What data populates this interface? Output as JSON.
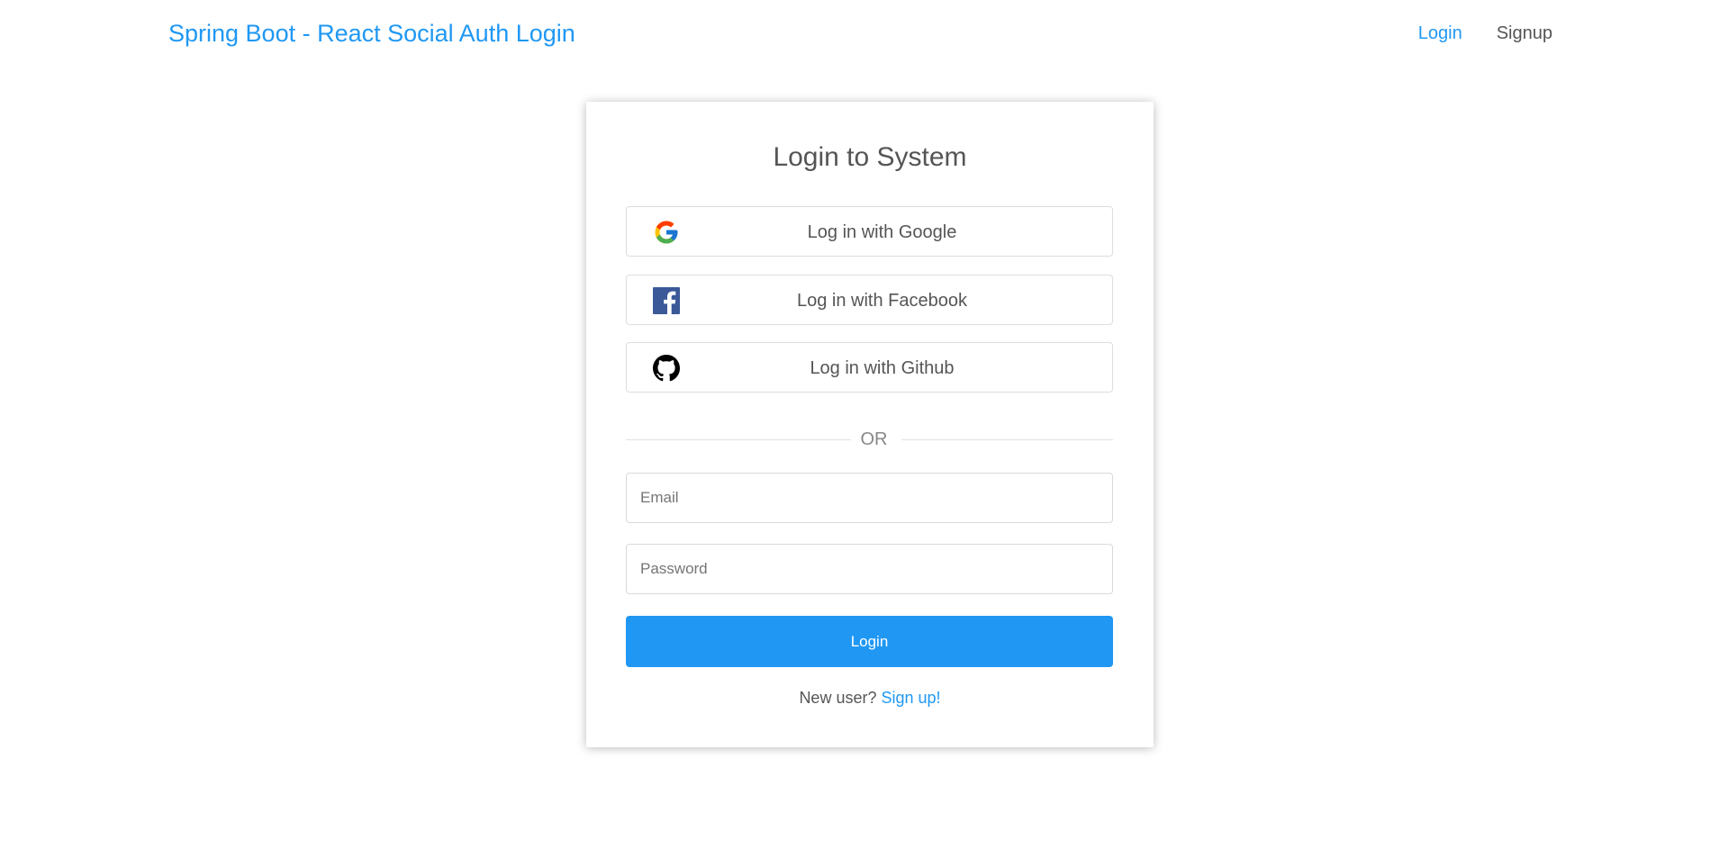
{
  "header": {
    "app_title": "Spring Boot - React Social Auth Login",
    "nav": {
      "login": "Login",
      "signup": "Signup"
    }
  },
  "login_card": {
    "title": "Login to System",
    "social": {
      "google": {
        "label": "Log in with Google",
        "icon": "google-icon"
      },
      "facebook": {
        "label": "Log in with Facebook",
        "icon": "facebook-icon"
      },
      "github": {
        "label": "Log in with Github",
        "icon": "github-icon"
      }
    },
    "divider_text": "OR",
    "email": {
      "placeholder": "Email",
      "value": ""
    },
    "password": {
      "placeholder": "Password",
      "value": ""
    },
    "login_button": "Login",
    "signup_prompt": "New user?",
    "signup_link": "Sign up!"
  },
  "colors": {
    "accent": "#2098f3",
    "text": "#555555",
    "facebook": "#3b5998",
    "github": "#000000"
  }
}
